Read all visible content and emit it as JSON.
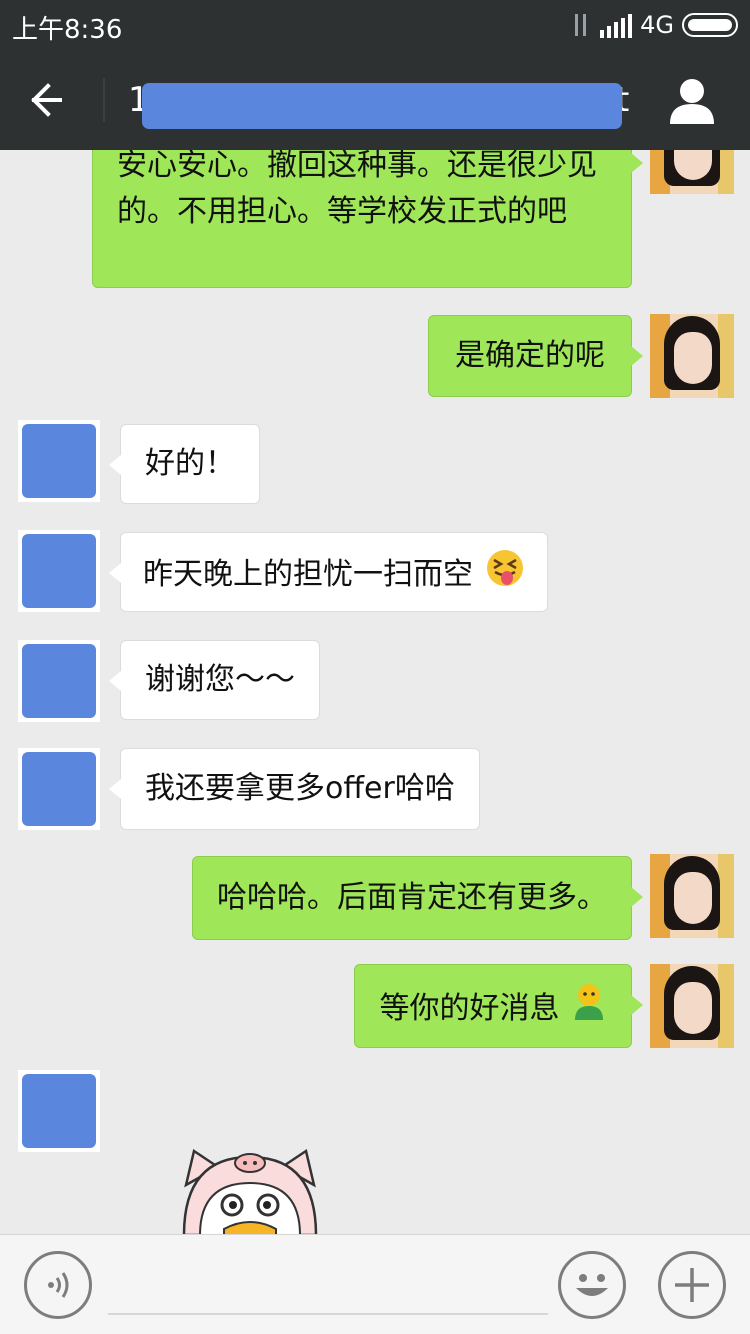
{
  "status_bar": {
    "time": "上午8:36",
    "network": "4G",
    "icons": [
      "data-arrows-icon",
      "signal-icon",
      "battery-icon"
    ]
  },
  "header": {
    "title_first_char": "1",
    "title_last_char": "t",
    "back_icon": "arrow-left-icon",
    "contact_icon": "person-icon"
  },
  "messages": [
    {
      "sender": "me",
      "text": "安心安心。撤回这种事。还是很少见的。不用担心。等学校发正式的吧"
    },
    {
      "sender": "me",
      "text": "是确定的呢"
    },
    {
      "sender": "other",
      "text": "好的！"
    },
    {
      "sender": "other",
      "text": "昨天晚上的担忧一扫而空",
      "emoji": "squinting-tongue-emoji"
    },
    {
      "sender": "other",
      "text": "谢谢您～～"
    },
    {
      "sender": "other",
      "text": "我还要拿更多offer哈哈"
    },
    {
      "sender": "me",
      "text": "哈哈哈。后面肯定还有更多。"
    },
    {
      "sender": "me",
      "text": "等你的好消息",
      "emoji": "green-figure-emoji"
    },
    {
      "sender": "other",
      "type": "sticker",
      "sticker": "pig-hood-duck-sticker"
    }
  ],
  "input_bar": {
    "placeholder": "",
    "voice_icon": "voice-icon",
    "emoji_icon": "smiley-icon",
    "plus_icon": "plus-icon"
  },
  "colors": {
    "bar_bg": "#2e3132",
    "chat_bg": "#ebebeb",
    "my_bubble": "#9fe658",
    "other_bubble": "#ffffff",
    "privacy_mask": "#5b86de"
  }
}
